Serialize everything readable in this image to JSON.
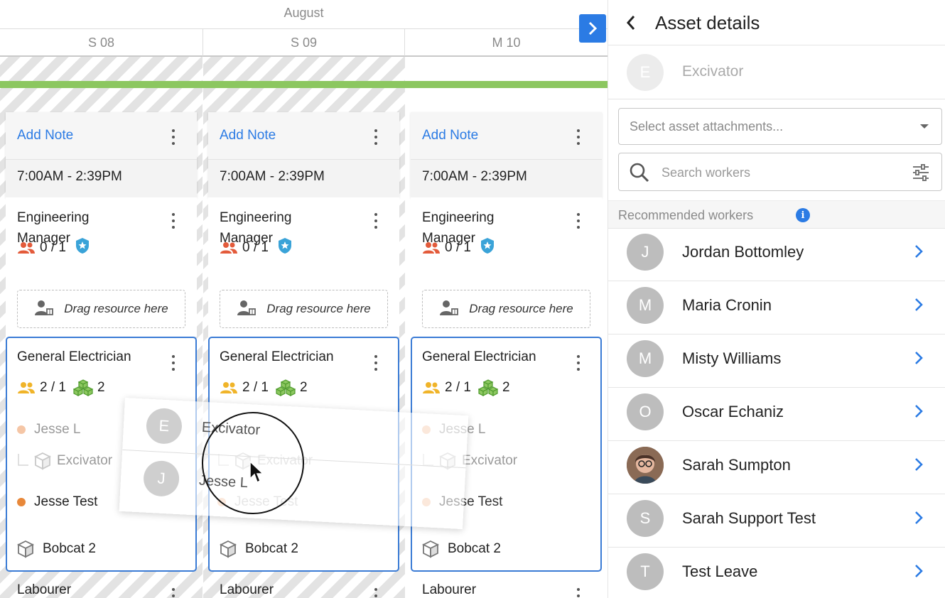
{
  "calendar": {
    "month": "August",
    "days": [
      "S 08",
      "S 09",
      "M 10"
    ],
    "next_icon": "chevron-right-icon",
    "columns": [
      {
        "add_note": "Add Note",
        "time": "7:00AM - 2:39PM",
        "role": {
          "title": "Engineering Manager",
          "count": "0 / 1"
        },
        "drag": "Drag resource here",
        "electrician": {
          "title": "General Electrician",
          "count": "2 / 1",
          "assets": "2",
          "worker1": "Jesse L",
          "asset1": "Excivator",
          "worker2": "Jesse Test",
          "asset2": "Bobcat 2"
        },
        "labourer": "Labourer"
      },
      {
        "add_note": "Add Note",
        "time": "7:00AM - 2:39PM",
        "role": {
          "title": "Engineering Manager",
          "count": "0 / 1"
        },
        "drag": "Drag resource here",
        "electrician": {
          "title": "General Electrician",
          "count": "2 / 1",
          "assets": "2",
          "worker1": "",
          "asset1": "",
          "worker2": "",
          "asset2": "Bobcat 2"
        },
        "labourer": "Labourer"
      },
      {
        "add_note": "Add Note",
        "time": "7:00AM - 2:39PM",
        "role": {
          "title": "Engineering Manager",
          "count": "0 / 1"
        },
        "drag": "Drag resource here",
        "electrician": {
          "title": "General Electrician",
          "count": "2 / 1",
          "assets": "2",
          "worker1": "Jesse L",
          "asset1": "Excivator",
          "worker2": "Jesse Test",
          "asset2": "Bobcat 2"
        },
        "labourer": "Labourer"
      }
    ],
    "ghost": {
      "rows": [
        {
          "initial": "E",
          "name": "Excivator"
        },
        {
          "initial": "J",
          "name": "Jesse L"
        }
      ],
      "under_asset": "Excivator",
      "under_worker": "Jesse Test"
    }
  },
  "panel": {
    "title": "Asset details",
    "asset": {
      "initial": "E",
      "name": "Excivator"
    },
    "attachments_placeholder": "Select asset attachments...",
    "search_placeholder": "Search workers",
    "recommended_label": "Recommended workers",
    "workers": [
      {
        "initial": "J",
        "name": "Jordan Bottomley"
      },
      {
        "initial": "M",
        "name": "Maria Cronin"
      },
      {
        "initial": "M",
        "name": "Misty Williams"
      },
      {
        "initial": "O",
        "name": "Oscar Echaniz"
      },
      {
        "initial": "",
        "name": "Sarah Sumpton",
        "photo": true
      },
      {
        "initial": "S",
        "name": "Sarah Support Test"
      },
      {
        "initial": "T",
        "name": "Test Leave"
      }
    ]
  },
  "colors": {
    "accent": "#2b7be4",
    "green_bar": "#8cc760",
    "card_border": "#3a7bd5",
    "dot_orange": "#e8883a",
    "dot_light": "#f5c6a6"
  }
}
